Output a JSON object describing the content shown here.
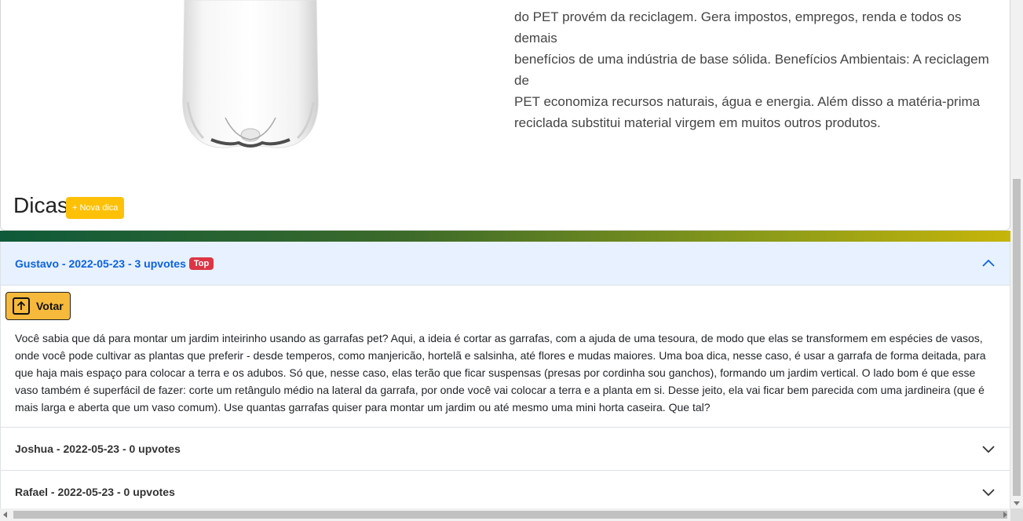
{
  "product": {
    "description_lines": [
      "do PET provém da reciclagem. Gera impostos, empregos, renda e todos os demais",
      "benefícios de uma indústria de base sólida. Benefícios Ambientais: A reciclagem de",
      "PET economiza recursos naturais, água e energia. Além disso a matéria-prima",
      "reciclada substitui material virgem em muitos outros produtos."
    ]
  },
  "dicas": {
    "title": "Dicas",
    "new_button": "+ Nova dica"
  },
  "tips": [
    {
      "header": "Gustavo - 2022-05-23 - 3 upvotes",
      "badge": "Top",
      "expanded": true,
      "vote_label": "Votar",
      "text": "Você sabia que dá para montar um jardim inteirinho usando as garrafas pet? Aqui, a ideia é cortar as garrafas, com a ajuda de uma tesoura, de modo que elas se transformem em espécies de vasos, onde você pode cultivar as plantas que preferir - desde temperos, como manjericão, hortelã e salsinha, até flores e mudas maiores. Uma boa dica, nesse caso, é usar a garrafa de forma deitada, para que haja mais espaço para colocar a terra e os adubos. Só que, nesse caso, elas terão que ficar suspensas (presas por cordinha sou ganchos), formando um jardim vertical. O lado bom é que esse vaso também é superfácil de fazer: corte um retângulo médio na lateral da garrafa, por onde você vai colocar a terra e a planta em si. Desse jeito, ela vai ficar bem parecida com uma jardineira (que é mais larga e aberta que um vaso comum). Use quantas garrafas quiser para montar um jardim ou até mesmo uma mini horta caseira. Que tal?"
    },
    {
      "header": "Joshua - 2022-05-23 - 0 upvotes",
      "expanded": false
    },
    {
      "header": "Rafael - 2022-05-23 - 0 upvotes",
      "expanded": false
    }
  ],
  "colors": {
    "accent_yellow": "#ffc107",
    "vote_orange": "#f6b93b",
    "active_header_bg": "#e7f1ff",
    "active_header_text": "#0c63e4",
    "badge_red": "#dc3545"
  },
  "icons": [
    "pet-bottle-image",
    "chevron-up-icon",
    "chevron-down-icon",
    "arrow-up-icon"
  ]
}
